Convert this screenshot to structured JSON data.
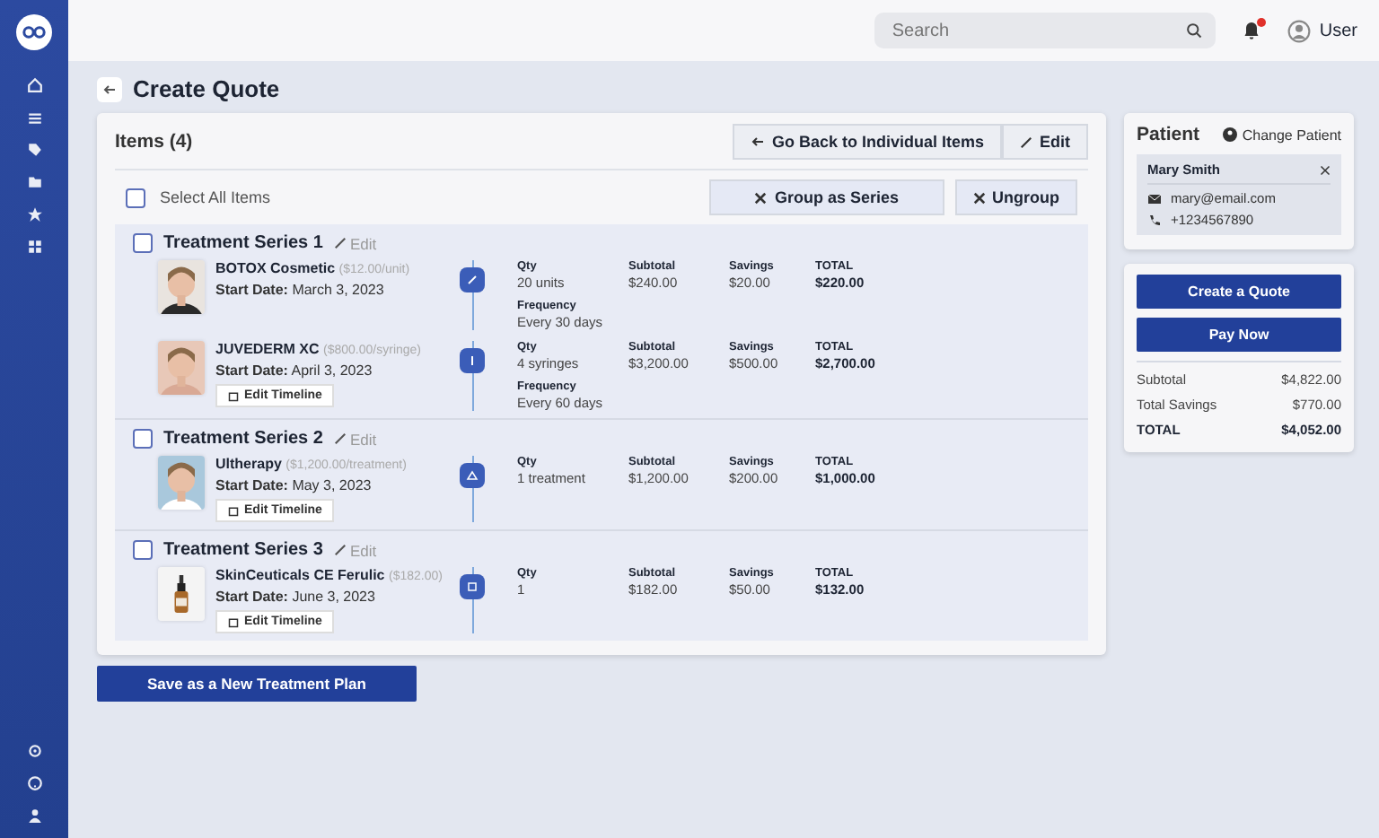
{
  "topbar": {
    "search": {
      "placeholder": "Search"
    },
    "notifications": {
      "unread": true
    },
    "user": "User"
  },
  "page": {
    "title": "Create Quote"
  },
  "items_panel": {
    "title": "Items (4)",
    "buttons": [
      "Go Back to Individual Items",
      "Edit"
    ],
    "select_all": {
      "label": "Select All Items",
      "checked": false
    },
    "group_buttons": [
      "Group as Series",
      "Ungroup"
    ],
    "series": [
      {
        "title": "Treatment Series 1",
        "edit": "Edit",
        "checked": false,
        "items": [
          {
            "name": "BOTOX Cosmetic",
            "price": "($12.00/unit)",
            "start_label": "Start Date:",
            "start": "March 3, 2023",
            "metrics": [
              {
                "label": "Qty",
                "value": "20 units"
              },
              {
                "label": "Subtotal",
                "value": "$240.00"
              },
              {
                "label": "Savings",
                "value": "$20.00"
              },
              {
                "label": "TOTAL",
                "value": "$220.00"
              }
            ],
            "frequency": {
              "label": "Frequency",
              "value": "Every 30 days"
            }
          },
          {
            "name": "JUVEDERM XC",
            "price": "($800.00/syringe)",
            "start_label": "Start Date:",
            "start": "April 3, 2023",
            "edit_timeline": "Edit Timeline",
            "metrics": [
              {
                "label": "Qty",
                "value": "4 syringes"
              },
              {
                "label": "Subtotal",
                "value": "$3,200.00"
              },
              {
                "label": "Savings",
                "value": "$500.00"
              },
              {
                "label": "TOTAL",
                "value": "$2,700.00"
              }
            ],
            "frequency": {
              "label": "Frequency",
              "value": "Every 60 days"
            }
          }
        ]
      },
      {
        "title": "Treatment Series 2",
        "edit": "Edit",
        "checked": false,
        "items": [
          {
            "name": "Ultherapy",
            "price": "($1,200.00/treatment)",
            "start_label": "Start Date:",
            "start": "May 3, 2023",
            "edit_timeline": "Edit Timeline",
            "metrics": [
              {
                "label": "Qty",
                "value": "1 treatment"
              },
              {
                "label": "Subtotal",
                "value": "$1,200.00"
              },
              {
                "label": "Savings",
                "value": "$200.00"
              },
              {
                "label": "TOTAL",
                "value": "$1,000.00"
              }
            ]
          }
        ]
      },
      {
        "title": "Treatment Series 3",
        "edit": "Edit",
        "checked": false,
        "items": [
          {
            "name": "SkinCeuticals CE Ferulic",
            "price": "($182.00)",
            "start_label": "Start Date:",
            "start": "June 3, 2023",
            "edit_timeline": "Edit Timeline",
            "metrics": [
              {
                "label": "Qty",
                "value": "1"
              },
              {
                "label": "Subtotal",
                "value": "$182.00"
              },
              {
                "label": "Savings",
                "value": "$50.00"
              },
              {
                "label": "TOTAL",
                "value": "$132.00"
              }
            ]
          }
        ]
      }
    ]
  },
  "patient": {
    "title": "Patient",
    "change": "Change Patient",
    "name": "Mary Smith",
    "email": "mary@email.com",
    "phone": "+1234567890"
  },
  "actions": [
    "Create a Quote",
    "Pay Now"
  ],
  "summary": [
    {
      "label": "Subtotal",
      "value": "$4,822.00",
      "kind": "line"
    },
    {
      "label": "Total Savings",
      "value": "$770.00",
      "kind": "line"
    },
    {
      "label": "TOTAL",
      "value": "$4,052.00",
      "kind": "total"
    }
  ],
  "save_button": "Save as a New Treatment Plan"
}
